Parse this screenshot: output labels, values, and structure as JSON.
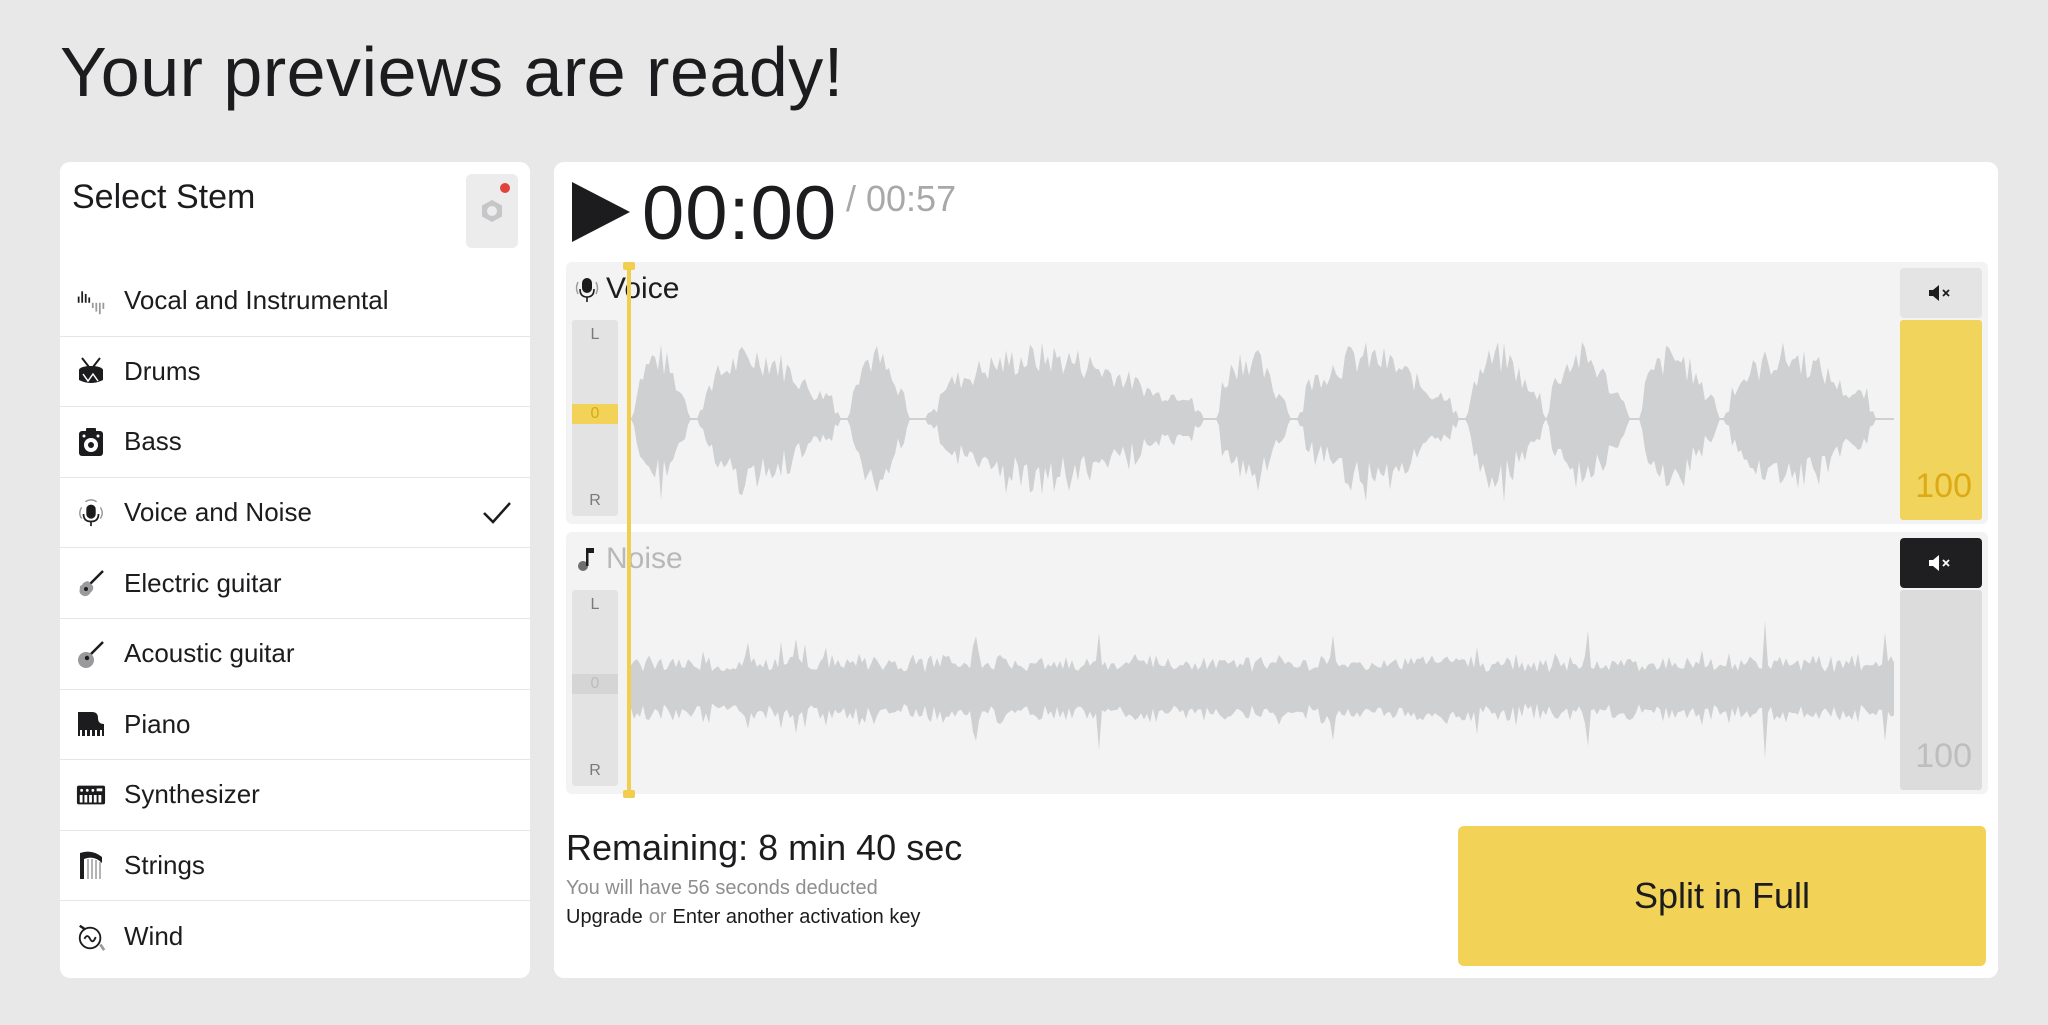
{
  "page": {
    "title": "Your previews are ready!"
  },
  "stems": {
    "title": "Select Stem",
    "settings_icon": "hexagon-settings-icon",
    "items": [
      {
        "label": "Vocal and Instrumental",
        "icon": "waveform-split-icon",
        "selected": false
      },
      {
        "label": "Drums",
        "icon": "drum-icon",
        "selected": false
      },
      {
        "label": "Bass",
        "icon": "bass-amp-icon",
        "selected": false
      },
      {
        "label": "Voice and Noise",
        "icon": "microphone-noise-icon",
        "selected": true
      },
      {
        "label": "Electric guitar",
        "icon": "electric-guitar-icon",
        "selected": false
      },
      {
        "label": "Acoustic guitar",
        "icon": "acoustic-guitar-icon",
        "selected": false
      },
      {
        "label": "Piano",
        "icon": "piano-icon",
        "selected": false
      },
      {
        "label": "Synthesizer",
        "icon": "synthesizer-icon",
        "selected": false
      },
      {
        "label": "Strings",
        "icon": "harp-icon",
        "selected": false
      },
      {
        "label": "Wind",
        "icon": "french-horn-icon",
        "selected": false
      }
    ]
  },
  "player": {
    "current_time": "00:00",
    "total_time": "00:57",
    "total_separator": "/",
    "tracks": [
      {
        "name": "Voice",
        "icon": "microphone-icon",
        "pan_left": "L",
        "pan_center": "0",
        "pan_right": "R",
        "volume": "100",
        "muted": false
      },
      {
        "name": "Noise",
        "icon": "music-note-icon",
        "pan_left": "L",
        "pan_center": "0",
        "pan_right": "R",
        "volume": "100",
        "muted": true
      }
    ]
  },
  "footer": {
    "remaining_label": "Remaining:",
    "remaining_value": "8 min 40 sec",
    "deduct_text": "You will have 56 seconds deducted",
    "upgrade_label": "Upgrade",
    "or_text": "or",
    "activation_label": "Enter another activation key",
    "split_button": "Split in Full"
  },
  "colors": {
    "accent": "#f2d257",
    "accent_text": "#dda917",
    "muted_dark": "#1f1f21",
    "notification": "#e0433b",
    "waveform": "#cfd0d2"
  }
}
